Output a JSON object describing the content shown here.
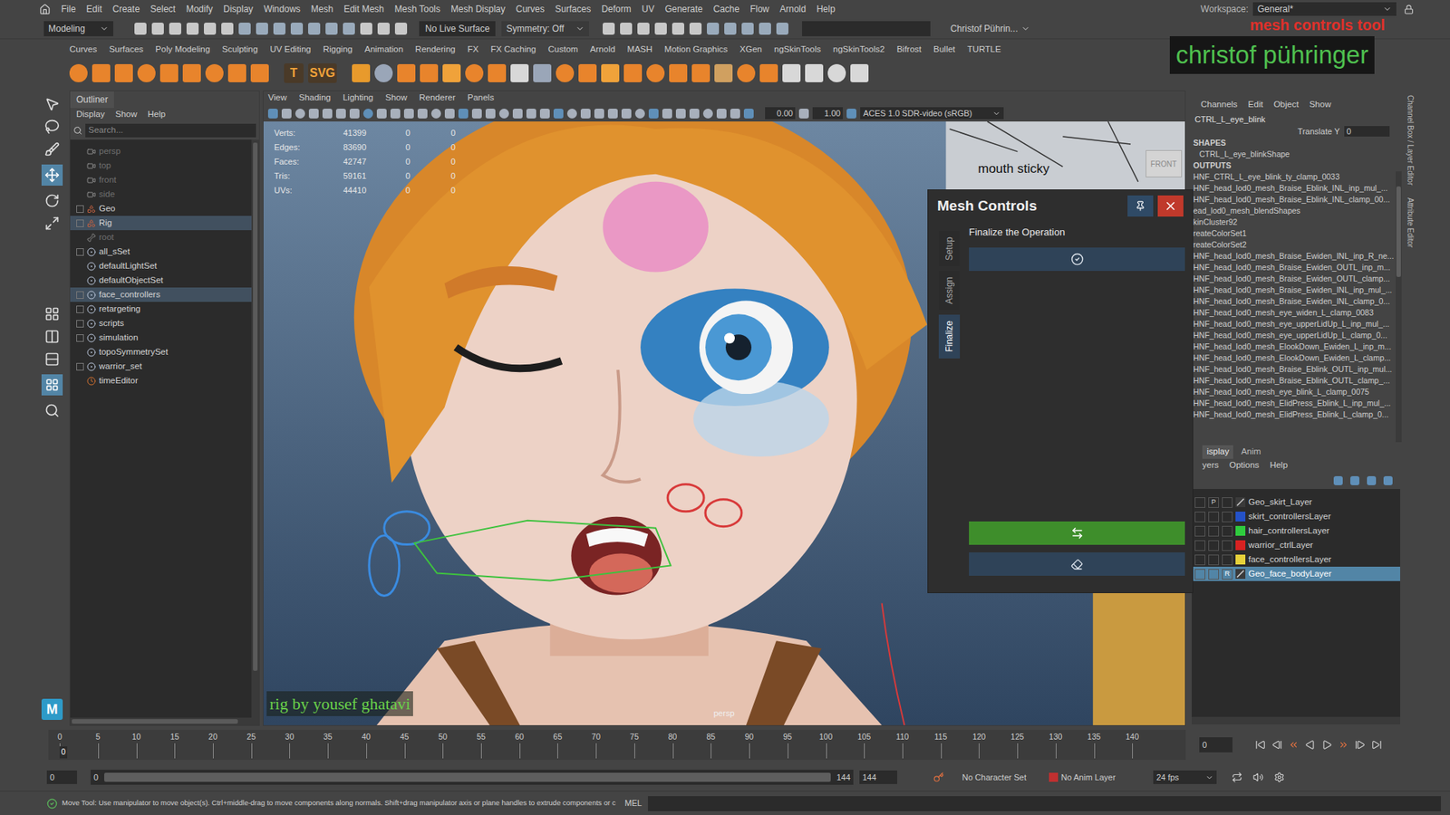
{
  "menubar": {
    "items": [
      "File",
      "Edit",
      "Create",
      "Select",
      "Modify",
      "Display",
      "Windows",
      "Mesh",
      "Edit Mesh",
      "Mesh Tools",
      "Mesh Display",
      "Curves",
      "Surfaces",
      "Deform",
      "UV",
      "Generate",
      "Cache",
      "Flow",
      "Arnold",
      "Help"
    ],
    "workspace_label": "Workspace:",
    "workspace": "General*"
  },
  "statusline": {
    "mode": "Modeling",
    "live_surface": "No Live Surface",
    "symmetry": "Symmetry: Off",
    "user": "Christof Pührin..."
  },
  "shelf": {
    "tabs": [
      "Curves",
      "Surfaces",
      "Poly Modeling",
      "Sculpting",
      "UV Editing",
      "Rigging",
      "Animation",
      "Rendering",
      "FX",
      "FX Caching",
      "Custom",
      "Arnold",
      "MASH",
      "Motion Graphics",
      "XGen",
      "ngSkinTools",
      "ngSkinTools2",
      "Bifrost",
      "Bullet",
      "TURTLE"
    ],
    "text_icons": [
      "T",
      "SVG"
    ]
  },
  "overlay": {
    "tool_title": "mesh controls tool",
    "author": "christof pühringer"
  },
  "outliner": {
    "title": "Outliner",
    "menu": [
      "Display",
      "Show",
      "Help"
    ],
    "search_placeholder": "Search...",
    "items": [
      {
        "label": "persp",
        "kind": "camera",
        "expandable": false,
        "dimmed": true,
        "selected": false
      },
      {
        "label": "top",
        "kind": "camera",
        "expandable": false,
        "dimmed": true,
        "selected": false
      },
      {
        "label": "front",
        "kind": "camera",
        "expandable": false,
        "dimmed": true,
        "selected": false
      },
      {
        "label": "side",
        "kind": "camera",
        "expandable": false,
        "dimmed": true,
        "selected": false
      },
      {
        "label": "Geo",
        "kind": "group",
        "expandable": true,
        "dimmed": false,
        "selected": false
      },
      {
        "label": "Rig",
        "kind": "group",
        "expandable": true,
        "dimmed": false,
        "selected": true
      },
      {
        "label": "root",
        "kind": "joint",
        "expandable": false,
        "dimmed": true,
        "selected": false
      },
      {
        "label": "all_sSet",
        "kind": "set",
        "expandable": true,
        "dimmed": false,
        "selected": false
      },
      {
        "label": "defaultLightSet",
        "kind": "set",
        "expandable": false,
        "dimmed": false,
        "selected": false
      },
      {
        "label": "defaultObjectSet",
        "kind": "set",
        "expandable": false,
        "dimmed": false,
        "selected": false
      },
      {
        "label": "face_controllers",
        "kind": "set",
        "expandable": true,
        "dimmed": false,
        "selected": true
      },
      {
        "label": "retargeting",
        "kind": "set",
        "expandable": true,
        "dimmed": false,
        "selected": false
      },
      {
        "label": "scripts",
        "kind": "set",
        "expandable": true,
        "dimmed": false,
        "selected": false
      },
      {
        "label": "simulation",
        "kind": "set",
        "expandable": true,
        "dimmed": false,
        "selected": false
      },
      {
        "label": "topoSymmetrySet",
        "kind": "set",
        "expandable": false,
        "dimmed": false,
        "selected": false
      },
      {
        "label": "warrior_set",
        "kind": "set",
        "expandable": true,
        "dimmed": false,
        "selected": false
      },
      {
        "label": "timeEditor",
        "kind": "editor",
        "expandable": false,
        "dimmed": false,
        "selected": false
      }
    ]
  },
  "viewport": {
    "menu": [
      "View",
      "Shading",
      "Lighting",
      "Show",
      "Renderer",
      "Panels"
    ],
    "near": "0.00",
    "far": "1.00",
    "color_space": "ACES 1.0 SDR-video (sRGB)",
    "hud": [
      {
        "label": "Verts:",
        "values": [
          "41399",
          "0",
          "0"
        ]
      },
      {
        "label": "Edges:",
        "values": [
          "83690",
          "0",
          "0"
        ]
      },
      {
        "label": "Faces:",
        "values": [
          "42747",
          "0",
          "0"
        ]
      },
      {
        "label": "Tris:",
        "values": [
          "59161",
          "0",
          "0"
        ]
      },
      {
        "label": "UVs:",
        "values": [
          "44410",
          "0",
          "0"
        ]
      }
    ],
    "picker_label": "mouth sticky",
    "view_cube": "FRONT",
    "camera": "persp",
    "credit": "rig by yousef ghatavi"
  },
  "mesh_controls": {
    "title": "Mesh Controls",
    "tabs": [
      {
        "label": "Setup",
        "selected": false
      },
      {
        "label": "Assign",
        "selected": false
      },
      {
        "label": "Finalize",
        "selected": true
      }
    ],
    "heading": "Finalize the Operation"
  },
  "channel_box": {
    "menu": [
      "Channels",
      "Edit",
      "Object",
      "Show"
    ],
    "node": "CTRL_L_eye_blink",
    "attribute": {
      "name": "Translate Y",
      "value": "0"
    },
    "shapes_header": "SHAPES",
    "shapes": [
      "CTRL_L_eye_blinkShape"
    ],
    "outputs_header": "OUTPUTS",
    "outputs": [
      "HNF_CTRL_L_eye_blink_ty_clamp_0033",
      "HNF_head_lod0_mesh_Braise_Eblink_INL_inp_mul_...",
      "HNF_head_lod0_mesh_Braise_Eblink_INL_clamp_00...",
      "ead_lod0_mesh_blendShapes",
      "kinCluster92",
      "reateColorSet1",
      "reateColorSet2",
      "HNF_head_lod0_mesh_Braise_Ewiden_INL_inp_R_ne...",
      "HNF_head_lod0_mesh_Braise_Ewiden_OUTL_inp_m...",
      "HNF_head_lod0_mesh_Braise_Ewiden_OUTL_clamp...",
      "HNF_head_lod0_mesh_Braise_Ewiden_INL_inp_mul_...",
      "HNF_head_lod0_mesh_Braise_Ewiden_INL_clamp_0...",
      "HNF_head_lod0_mesh_eye_widen_L_clamp_0083",
      "HNF_head_lod0_mesh_eye_upperLidUp_L_inp_mul_...",
      "HNF_head_lod0_mesh_eye_upperLidUp_L_clamp_0...",
      "HNF_head_lod0_mesh_ElookDown_Ewiden_L_inp_m...",
      "HNF_head_lod0_mesh_ElookDown_Ewiden_L_clamp...",
      "HNF_head_lod0_mesh_Braise_Eblink_OUTL_inp_mul...",
      "HNF_head_lod0_mesh_Braise_Eblink_OUTL_clamp_...",
      "HNF_head_lod0_mesh_eye_blink_L_clamp_0075",
      "HNF_head_lod0_mesh_ElidPress_Eblink_L_inp_mul_...",
      "HNF_head_lod0_mesh_ElidPress_Eblink_L_clamp_0..."
    ]
  },
  "layer_editor": {
    "tabs": [
      {
        "label": "isplay",
        "selected": true
      },
      {
        "label": "Anim",
        "selected": false
      }
    ],
    "menu": [
      "yers",
      "Options",
      "Help"
    ],
    "layers": [
      {
        "name": "Geo_skirt_Layer",
        "kind": "geo",
        "color": "#3a3a3a",
        "flag": "P",
        "selected": false
      },
      {
        "name": "skirt_controllersLayer",
        "kind": "ctrl",
        "color": "#2452c8",
        "flag": "",
        "selected": false
      },
      {
        "name": "hair_controllersLayer",
        "kind": "ctrl",
        "color": "#2fcc3e",
        "flag": "",
        "selected": false
      },
      {
        "name": "warrior_ctrlLayer",
        "kind": "ctrl",
        "color": "#d82222",
        "flag": "",
        "selected": false
      },
      {
        "name": "face_controllersLayer",
        "kind": "ctrl",
        "color": "#e6d13a",
        "flag": "",
        "selected": false
      },
      {
        "name": "Geo_face_bodyLayer",
        "kind": "geo",
        "color": "#3a3a3a",
        "flag": "R",
        "selected": true
      }
    ]
  },
  "side_tabs": [
    "Channel Box / Layer Editor",
    "Attribute Editor"
  ],
  "timeline": {
    "ticks": [
      "0",
      "5",
      "10",
      "15",
      "20",
      "25",
      "30",
      "35",
      "40",
      "45",
      "50",
      "55",
      "60",
      "65",
      "70",
      "75",
      "80",
      "85",
      "90",
      "95",
      "100",
      "105",
      "110",
      "115",
      "120",
      "125",
      "130",
      "135",
      "140"
    ],
    "current_frame": "0",
    "end_frame": "144"
  },
  "range": {
    "start": "0",
    "range_start": "0",
    "range_end": "144",
    "end": "144",
    "character_set": "No Character Set",
    "anim_layer": "No Anim Layer",
    "fps": "24 fps"
  },
  "command": {
    "help": "Move Tool: Use manipulator to move object(s). Ctrl+middle-drag to move components along normals. Shift+drag manipulator axis or plane handles to extrude components or c",
    "language": "MEL"
  },
  "logo": "M"
}
